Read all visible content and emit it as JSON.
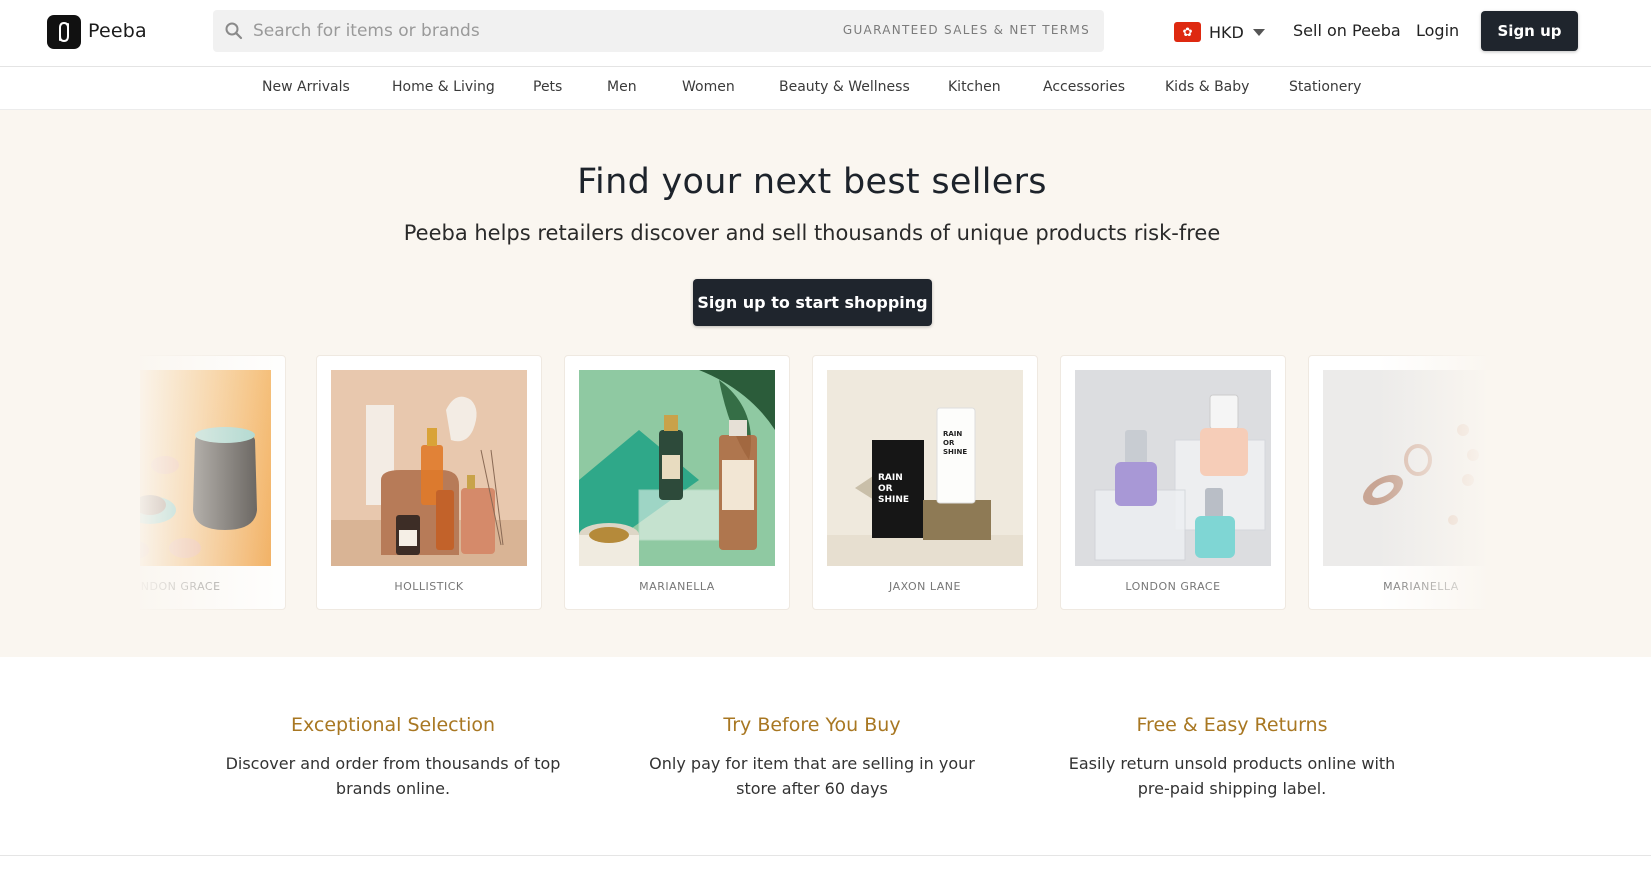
{
  "header": {
    "brand": "Peeba",
    "search_placeholder": "Search for items or brands",
    "search_tag": "GUARANTEED SALES & NET TERMS",
    "currency": "HKD",
    "flag_symbol": "✿",
    "sell_link": "Sell on Peeba",
    "login_link": "Login",
    "signup_button": "Sign up"
  },
  "nav": {
    "categories": [
      "New Arrivals",
      "Home & Living",
      "Pets",
      "Men",
      "Women",
      "Beauty & Wellness",
      "Kitchen",
      "Accessories",
      "Kids & Baby",
      "Stationery"
    ]
  },
  "hero": {
    "title": "Find your next best sellers",
    "subtitle": "Peeba helps retailers discover and sell thousands of unique products risk-free",
    "cta": "Sign up to start shopping"
  },
  "carousel": {
    "cards": [
      {
        "brand": "LONDON GRACE",
        "image": "tea-set-image"
      },
      {
        "brand": "HOLLISTICK",
        "image": "serum-bottles-image"
      },
      {
        "brand": "MARIANELLA",
        "image": "skincare-jars-image"
      },
      {
        "brand": "JAXON LANE",
        "image": "rain-or-shine-image"
      },
      {
        "brand": "LONDON GRACE",
        "image": "nail-polish-image"
      },
      {
        "brand": "MARIANELLA",
        "image": "jewelry-image"
      }
    ],
    "product_text": {
      "rain": "RAIN",
      "or": "OR",
      "shine": "SHINE"
    }
  },
  "features": [
    {
      "title": "Exceptional Selection",
      "desc_line1": "Discover and order from thousands of top",
      "desc_line2": "brands online."
    },
    {
      "title": "Try Before You Buy",
      "desc_line1": "Only pay for item that are selling in your",
      "desc_line2": "store after 60 days"
    },
    {
      "title": "Free & Easy Returns",
      "desc_line1": "Easily return unsold products online with",
      "desc_line2": "pre-paid shipping label."
    }
  ],
  "colors": {
    "dark_button": "#1f252d",
    "hero_bg": "#faf6f0",
    "feature_title": "#a87722",
    "flag_red": "#de2910"
  }
}
